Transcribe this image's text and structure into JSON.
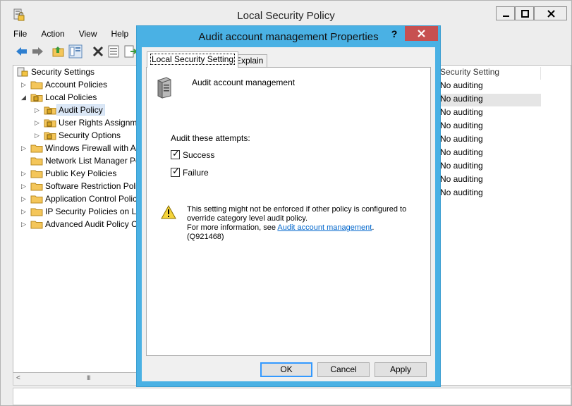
{
  "main_window": {
    "title": "Local Security Policy",
    "controls": {
      "minimize": "–",
      "maximize": "□",
      "close": "✕"
    }
  },
  "menu": [
    "File",
    "Action",
    "View",
    "Help"
  ],
  "toolbar_icons": [
    "back-arrow-icon",
    "forward-arrow-icon",
    "up-folder-icon",
    "show-hide-tree-icon",
    "delete-icon",
    "properties-icon",
    "export-list-icon"
  ],
  "tree": {
    "root": "Security Settings",
    "items": [
      {
        "label": "Account Policies",
        "level": 1,
        "arrow": "▷"
      },
      {
        "label": "Local Policies",
        "level": 1,
        "arrow": "◢"
      },
      {
        "label": "Audit Policy",
        "level": 2,
        "arrow": "▷",
        "selected": true
      },
      {
        "label": "User Rights Assignme",
        "level": 2,
        "arrow": "▷"
      },
      {
        "label": "Security Options",
        "level": 2,
        "arrow": "▷"
      },
      {
        "label": "Windows Firewall with Ac",
        "level": 1,
        "arrow": "▷"
      },
      {
        "label": "Network List Manager Po",
        "level": 1,
        "arrow": ""
      },
      {
        "label": "Public Key Policies",
        "level": 1,
        "arrow": "▷"
      },
      {
        "label": "Software Restriction Polic",
        "level": 1,
        "arrow": "▷"
      },
      {
        "label": "Application Control Polic",
        "level": 1,
        "arrow": "▷"
      },
      {
        "label": "IP Security Policies on Lo",
        "level": 1,
        "arrow": "▷"
      },
      {
        "label": "Advanced Audit Policy C",
        "level": 1,
        "arrow": "▷"
      }
    ],
    "scroll_left": "<",
    "scroll_thumb": "III"
  },
  "list": {
    "column_header": "Security Setting",
    "values": [
      "No auditing",
      "No auditing",
      "No auditing",
      "No auditing",
      "No auditing",
      "No auditing",
      "No auditing",
      "No auditing",
      "No auditing"
    ]
  },
  "dialog": {
    "title": "Audit account management Properties",
    "help": "?",
    "close": "✕",
    "tabs": [
      "Local Security Setting",
      "Explain"
    ],
    "policy_name": "Audit account management",
    "audit_label": "Audit these attempts:",
    "checkboxes": [
      {
        "label": "Success",
        "checked": true
      },
      {
        "label": "Failure",
        "checked": true
      }
    ],
    "warning_line1": "This setting might not be enforced if other policy is configured to",
    "warning_line2": "override category level audit policy.",
    "warning_line3_prefix": "For more information, see ",
    "warning_link": "Audit account management",
    "warning_line3_suffix": ". (Q921468)",
    "buttons": {
      "ok": "OK",
      "cancel": "Cancel",
      "apply": "Apply"
    }
  },
  "colors": {
    "dialog_frame": "#4ab1e4",
    "close_red": "#c75050",
    "link": "#0066cc",
    "selection": "#dbe7f6"
  }
}
